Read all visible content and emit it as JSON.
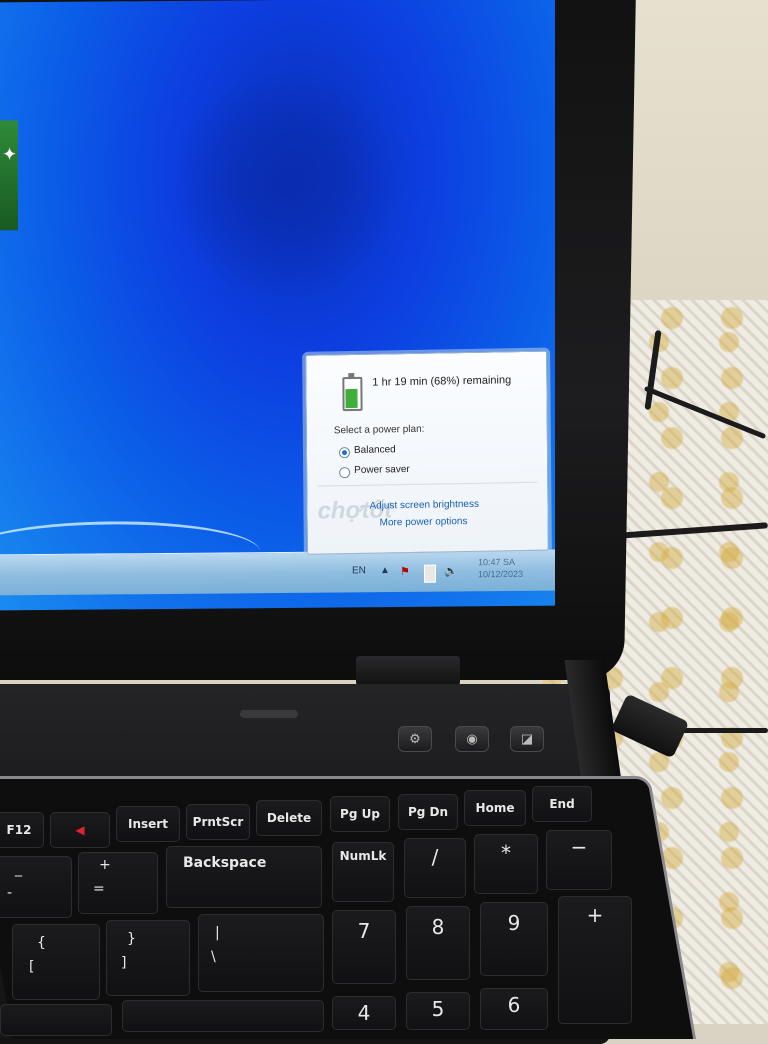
{
  "flyout": {
    "remaining": "1 hr 19 min (68%) remaining",
    "plan_header": "Select a power plan:",
    "plans": [
      {
        "label": "Balanced",
        "selected": true
      },
      {
        "label": "Power saver",
        "selected": false
      }
    ],
    "links": {
      "brightness": "Adjust screen brightness",
      "options": "More power options"
    },
    "battery_level": 0.68
  },
  "taskbar": {
    "lang": "EN",
    "time": "10:47 SA",
    "date": "10/12/2023"
  },
  "keys": {
    "f12": "F12",
    "insert": "Insert",
    "prntscr": "PrntScr",
    "delete": "Delete",
    "pgup": "Pg Up",
    "pgdn": "Pg Dn",
    "home": "Home",
    "end": "End",
    "minus_top": "_",
    "minus_bottom": "-",
    "plus_top": "+",
    "plus_bottom": "=",
    "backspace": "Backspace",
    "numlk": "NumLk",
    "slash": "/",
    "asterisk": "*",
    "num_minus": "−",
    "brace_top": "{",
    "brace_bottom": "[",
    "rbrace_top": "}",
    "rbrace_bottom": "]",
    "pipe_top": "|",
    "pipe_bottom": "\\",
    "n7": "7",
    "n8": "8",
    "n9": "9",
    "num_plus": "+",
    "n4": "4",
    "n5": "5",
    "n6": "6"
  },
  "watermark": "chợtốt"
}
